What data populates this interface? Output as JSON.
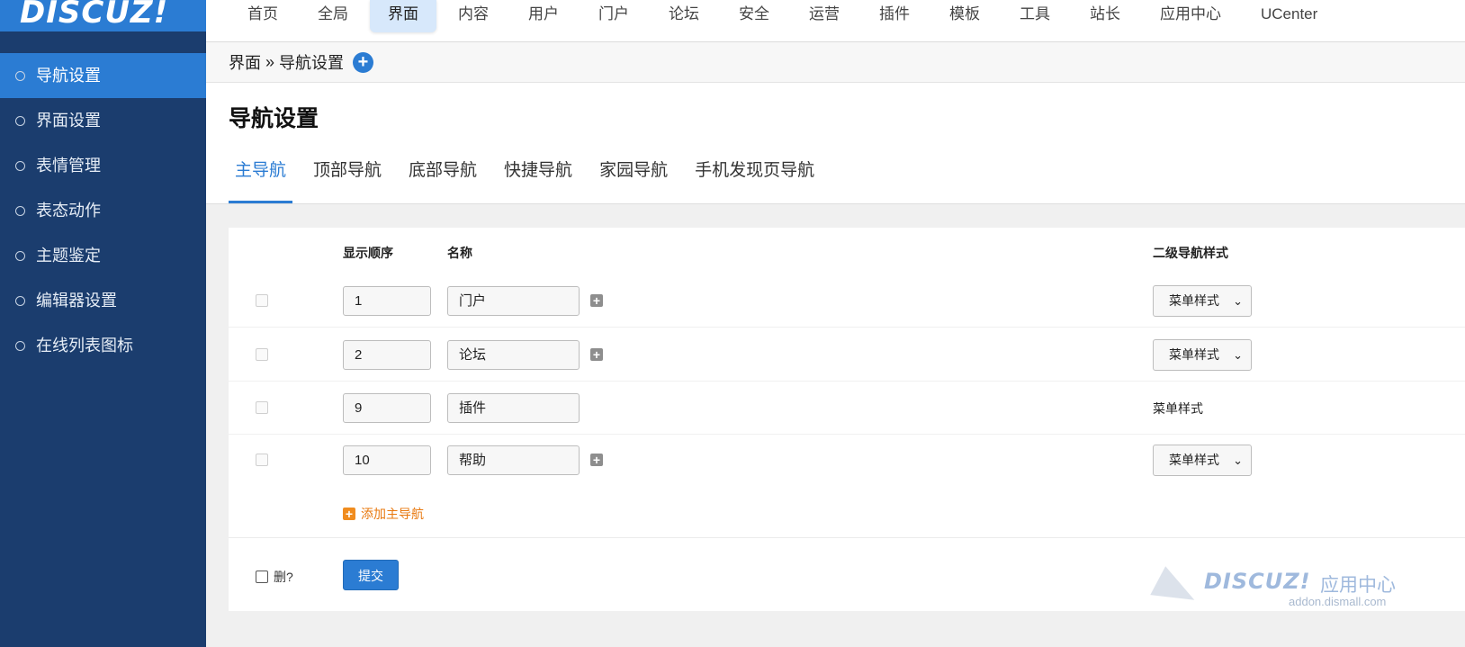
{
  "logo": {
    "text": "DISCUZ!"
  },
  "topnav": {
    "items": [
      "首页",
      "全局",
      "界面",
      "内容",
      "用户",
      "门户",
      "论坛",
      "安全",
      "运营",
      "插件",
      "模板",
      "工具",
      "站长",
      "应用中心",
      "UCenter"
    ],
    "active": "界面"
  },
  "sidebar": {
    "items": [
      "导航设置",
      "界面设置",
      "表情管理",
      "表态动作",
      "主题鉴定",
      "编辑器设置",
      "在线列表图标"
    ],
    "active": "导航设置"
  },
  "breadcrumb": {
    "section": "界面",
    "separator": "»",
    "page": "导航设置",
    "add_icon": "+"
  },
  "page_title": "导航设置",
  "tabs": {
    "items": [
      "主导航",
      "顶部导航",
      "底部导航",
      "快捷导航",
      "家园导航",
      "手机发现页导航"
    ],
    "active": "主导航"
  },
  "table": {
    "headers": {
      "order": "显示顺序",
      "name": "名称",
      "sub_style": "二级导航样式"
    },
    "rows": [
      {
        "order": "1",
        "name": "门户",
        "has_sub_add": true,
        "style": "菜单样式",
        "style_select": true
      },
      {
        "order": "2",
        "name": "论坛",
        "has_sub_add": true,
        "style": "菜单样式",
        "style_select": true
      },
      {
        "order": "9",
        "name": "插件",
        "has_sub_add": false,
        "style": "菜单样式",
        "style_select": false
      },
      {
        "order": "10",
        "name": "帮助",
        "has_sub_add": true,
        "style": "菜单样式",
        "style_select": true
      }
    ],
    "add_label": "添加主导航"
  },
  "footer": {
    "delete_label": "删?",
    "submit_label": "提交"
  },
  "watermark": {
    "brand": "DISCUZ!",
    "zh": "应用中心",
    "url": "addon.dismall.com"
  },
  "icons": {
    "sub_add": "plus-square-icon",
    "add_main": "plus-square-icon",
    "select_chevron": "chevron-down-icon"
  },
  "colors": {
    "accent": "#2b7cd3",
    "sidebar": "#1b3d6e",
    "add_link": "#e8780e"
  }
}
